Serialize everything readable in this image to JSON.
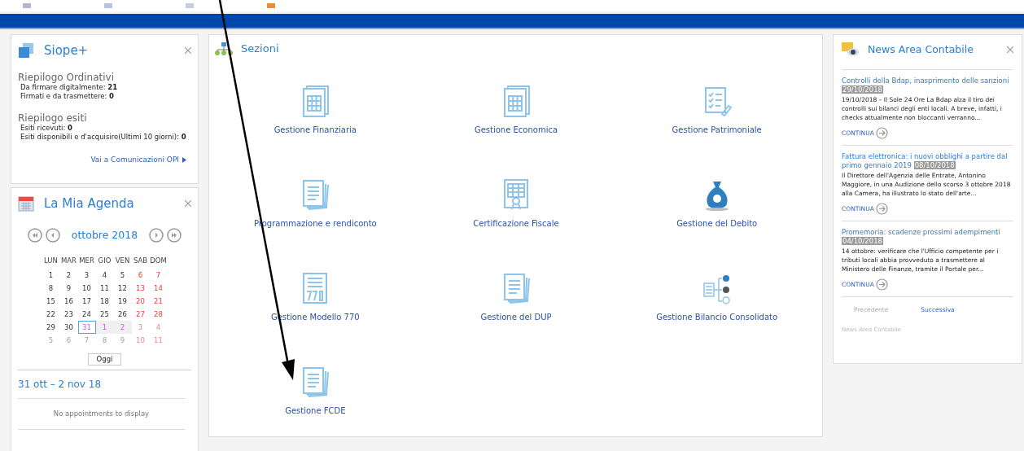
{
  "siope": {
    "title": "Siope+",
    "groups": [
      {
        "heading": "Riepilogo Ordinativi",
        "lines": [
          {
            "label": "Da firmare digitalmente:",
            "value": "21"
          },
          {
            "label": "Firmati e da trasmettere:",
            "value": "0"
          }
        ]
      },
      {
        "heading": "Riepilogo esiti",
        "lines": [
          {
            "label": "Esiti ricevuti:",
            "value": "0"
          },
          {
            "label": "Esiti disponibili e d'acquisire(Ultimi 10 giorni):",
            "value": "0"
          }
        ]
      }
    ],
    "link": "Vai a Comunicazioni OPI"
  },
  "agenda": {
    "title": "La Mia Agenda",
    "month": "ottobre 2018",
    "weekdays": [
      "LUN",
      "MAR",
      "MER",
      "GIO",
      "VEN",
      "SAB",
      "DOM"
    ],
    "weeks": [
      [
        {
          "day": "1",
          "kind": "weekday",
          "selected": false
        },
        {
          "day": "2",
          "kind": "weekday",
          "selected": false
        },
        {
          "day": "3",
          "kind": "weekday",
          "selected": false
        },
        {
          "day": "4",
          "kind": "weekday",
          "selected": false
        },
        {
          "day": "5",
          "kind": "weekday",
          "selected": false
        },
        {
          "day": "6",
          "kind": "weekend",
          "selected": false
        },
        {
          "day": "7",
          "kind": "weekend",
          "selected": false
        }
      ],
      [
        {
          "day": "8",
          "kind": "weekday",
          "selected": false
        },
        {
          "day": "9",
          "kind": "weekday",
          "selected": false
        },
        {
          "day": "10",
          "kind": "weekday",
          "selected": false
        },
        {
          "day": "11",
          "kind": "weekday",
          "selected": false
        },
        {
          "day": "12",
          "kind": "weekday",
          "selected": false
        },
        {
          "day": "13",
          "kind": "weekend",
          "selected": false
        },
        {
          "day": "14",
          "kind": "weekend",
          "selected": false
        }
      ],
      [
        {
          "day": "15",
          "kind": "weekday",
          "selected": false
        },
        {
          "day": "16",
          "kind": "weekday",
          "selected": false
        },
        {
          "day": "17",
          "kind": "weekday",
          "selected": false
        },
        {
          "day": "18",
          "kind": "weekday",
          "selected": false
        },
        {
          "day": "19",
          "kind": "weekday",
          "selected": false
        },
        {
          "day": "20",
          "kind": "weekend",
          "selected": false
        },
        {
          "day": "21",
          "kind": "weekend",
          "selected": false
        }
      ],
      [
        {
          "day": "22",
          "kind": "weekday",
          "selected": false
        },
        {
          "day": "23",
          "kind": "weekday",
          "selected": false
        },
        {
          "day": "24",
          "kind": "weekday",
          "selected": false
        },
        {
          "day": "25",
          "kind": "weekday",
          "selected": false
        },
        {
          "day": "26",
          "kind": "weekday",
          "selected": false
        },
        {
          "day": "27",
          "kind": "weekend",
          "selected": false
        },
        {
          "day": "28",
          "kind": "weekend",
          "selected": false
        }
      ],
      [
        {
          "day": "29",
          "kind": "weekday",
          "selected": false
        },
        {
          "day": "30",
          "kind": "weekday",
          "selected": false
        },
        {
          "day": "31",
          "kind": "range",
          "selected": true
        },
        {
          "day": "1",
          "kind": "range",
          "selected": false
        },
        {
          "day": "2",
          "kind": "range",
          "selected": false
        },
        {
          "day": "3",
          "kind": "outside-weekend",
          "selected": false
        },
        {
          "day": "4",
          "kind": "outside-weekend",
          "selected": false
        }
      ],
      [
        {
          "day": "5",
          "kind": "outside",
          "selected": false
        },
        {
          "day": "6",
          "kind": "outside",
          "selected": false
        },
        {
          "day": "7",
          "kind": "outside",
          "selected": false
        },
        {
          "day": "8",
          "kind": "outside",
          "selected": false
        },
        {
          "day": "9",
          "kind": "outside",
          "selected": false
        },
        {
          "day": "10",
          "kind": "outside-weekend",
          "selected": false
        },
        {
          "day": "11",
          "kind": "outside-weekend",
          "selected": false
        }
      ]
    ],
    "today_button": "Oggi",
    "range": "31 ott – 2 nov 18",
    "empty": "No appointments to display"
  },
  "sections": {
    "title": "Sezioni",
    "items": [
      {
        "label": "Gestione Finanziaria",
        "kind": "grid"
      },
      {
        "label": "Gestione Economica",
        "kind": "grid"
      },
      {
        "label": "Gestione Patrimoniale",
        "kind": "checklist"
      },
      {
        "label": "Programmazione e rendiconto",
        "kind": "pages"
      },
      {
        "label": "Certificazione Fiscale",
        "kind": "certificate"
      },
      {
        "label": "Gestione del Debito",
        "kind": "moneybag"
      },
      {
        "label": "Gestione Modello 770",
        "kind": "form770"
      },
      {
        "label": "Gestione del DUP",
        "kind": "pages"
      },
      {
        "label": "Gestione Bilancio Consolidato",
        "kind": "org"
      },
      {
        "label": "Gestione FCDE",
        "kind": "pages"
      }
    ]
  },
  "news": {
    "title": "News Area Contabile",
    "items": [
      {
        "title": "Controlli della Bdap, inasprimento delle sanzioni",
        "date": "29/10/2018",
        "body": "19/10/2018 – Il Sole 24 Ore La Bdap alza il tiro dei controlli sui bilanci degli enti locali. A breve, infatti, i checks attualmente non bloccanti verranno...",
        "more": "CONTINUA"
      },
      {
        "title": "Fattura elettronica: i nuovi obblighi a partire dal primo gennaio 2019",
        "date": "08/10/2018",
        "body": "Il Direttore dell'Agenzia delle Entrate, Antonino Maggiore, in una Audizione dello scorso 3 ottobre 2018 alla Camera, ha illustrato lo stato dell'arte...",
        "more": "CONTINUA"
      },
      {
        "title": "Promemoria: scadenze prossimi adempimenti",
        "date": "04/10/2018",
        "body": "14 ottobre: verificare che l'Ufficio competente per i tributi locali abbia provveduto a trasmettere al Ministero delle Finanze, tramite il Portale per...",
        "more": "CONTINUA"
      }
    ],
    "pager": [
      {
        "label": "Precedente",
        "disabled": true
      },
      {
        "label": "Successiva",
        "disabled": false
      }
    ],
    "footer": "News Area Contabile"
  }
}
